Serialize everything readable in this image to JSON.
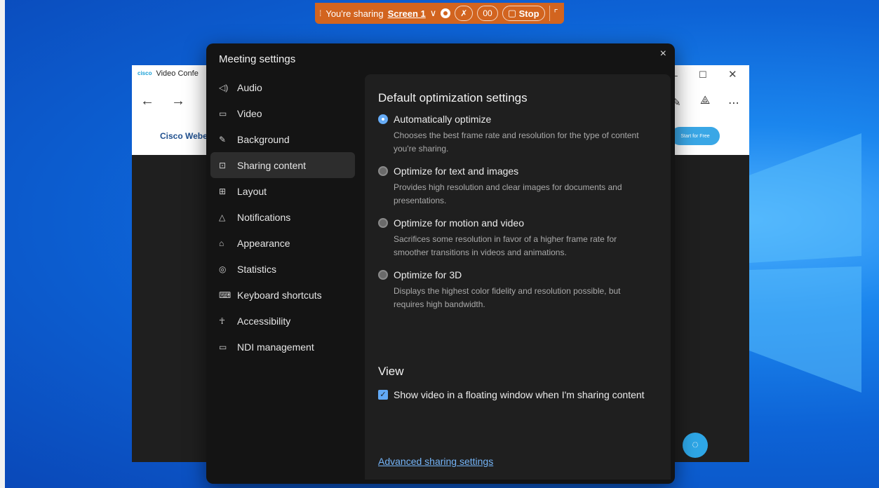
{
  "sharebar": {
    "grip": "⁞",
    "prefix": "You're sharing",
    "screen": "Screen 1",
    "chevron": "∨",
    "stop_label": "Stop",
    "pause_icon": "00"
  },
  "browser": {
    "tab_title": "Video Confe",
    "logo_text": "cisco",
    "brand": "Cisco Webe",
    "start_free": "Start for Free"
  },
  "dialog": {
    "title": "Meeting settings",
    "close": "×"
  },
  "sidebar": {
    "items": [
      {
        "label": "Audio",
        "icon": "speaker-icon",
        "glyph": "◁)"
      },
      {
        "label": "Video",
        "icon": "camera-icon",
        "glyph": "▭"
      },
      {
        "label": "Background",
        "icon": "magic-wand-icon",
        "glyph": "✎"
      },
      {
        "label": "Sharing content",
        "icon": "share-screen-icon",
        "glyph": "⊡",
        "active": true
      },
      {
        "label": "Layout",
        "icon": "layout-icon",
        "glyph": "⊞"
      },
      {
        "label": "Notifications",
        "icon": "bell-icon",
        "glyph": "△"
      },
      {
        "label": "Appearance",
        "icon": "appearance-icon",
        "glyph": "⌂"
      },
      {
        "label": "Statistics",
        "icon": "statistics-icon",
        "glyph": "◎"
      },
      {
        "label": "Keyboard shortcuts",
        "icon": "keyboard-icon",
        "glyph": "⌨"
      },
      {
        "label": "Accessibility",
        "icon": "accessibility-icon",
        "glyph": "☥"
      },
      {
        "label": "NDI management",
        "icon": "ndi-icon",
        "glyph": "▭"
      }
    ]
  },
  "content": {
    "heading": "Default optimization settings",
    "options": [
      {
        "label": "Automatically optimize",
        "desc": "Chooses the best frame rate and resolution for the type of content you're sharing.",
        "selected": true
      },
      {
        "label": "Optimize for text and images",
        "desc": "Provides high resolution and clear images for documents and presentations.",
        "selected": false
      },
      {
        "label": "Optimize for motion and video",
        "desc": "Sacrifices some resolution in favor of a higher frame rate for smoother transitions in videos and animations.",
        "selected": false
      },
      {
        "label": "Optimize for 3D",
        "desc": "Displays the highest color fidelity and resolution possible, but requires high bandwidth.",
        "selected": false
      }
    ],
    "view_heading": "View",
    "view_option": "Show video in a floating window when I'm sharing content",
    "view_checked": true,
    "advanced_link": "Advanced sharing settings"
  }
}
